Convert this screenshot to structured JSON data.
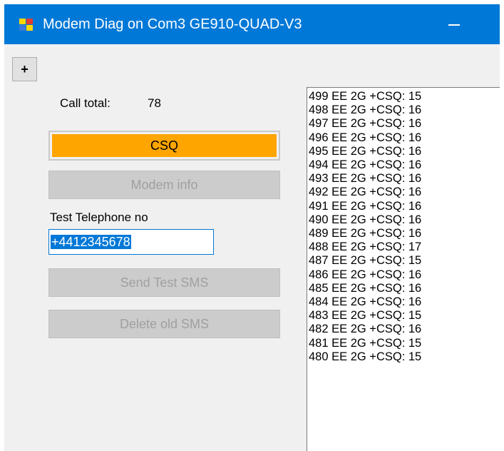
{
  "window": {
    "title": "Modem Diag on Com3 GE910-QUAD-V3",
    "icon": "app-window-icon",
    "title_bar_color": "#0078d7"
  },
  "toolbar": {
    "plus_label": "+"
  },
  "calls": {
    "total_label": "Call total:",
    "total_value": "78"
  },
  "buttons": {
    "csq": "CSQ",
    "csq_color": "#ffa500",
    "modem_info": "Modem info",
    "send_test_sms": "Send Test SMS",
    "delete_old_sms": "Delete old SMS"
  },
  "phone": {
    "label": "Test Telephone no",
    "value": "+4412345678"
  },
  "log": {
    "items": [
      "499 EE 2G +CSQ: 15",
      "498 EE 2G +CSQ: 16",
      "497 EE 2G +CSQ: 16",
      "496 EE 2G +CSQ: 16",
      "495 EE 2G +CSQ: 16",
      "494 EE 2G +CSQ: 16",
      "493 EE 2G +CSQ: 16",
      "492 EE 2G +CSQ: 16",
      "491 EE 2G +CSQ: 16",
      "490 EE 2G +CSQ: 16",
      "489 EE 2G +CSQ: 16",
      "488 EE 2G +CSQ: 17",
      "487 EE 2G +CSQ: 15",
      "486 EE 2G +CSQ: 16",
      "485 EE 2G +CSQ: 16",
      "484 EE 2G +CSQ: 16",
      "483 EE 2G +CSQ: 15",
      "482 EE 2G +CSQ: 16",
      "481 EE 2G +CSQ: 15",
      "480 EE 2G +CSQ: 15"
    ]
  }
}
